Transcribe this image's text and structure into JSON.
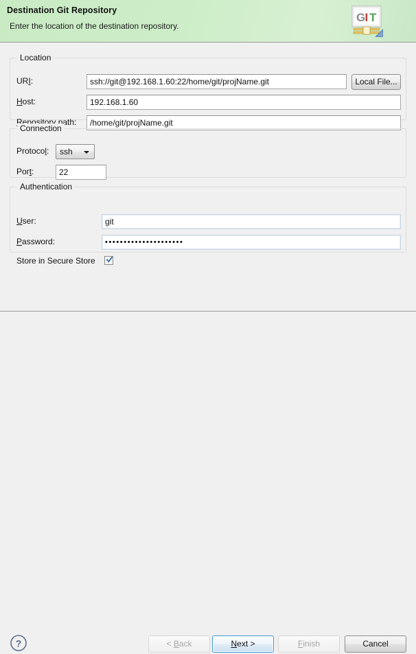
{
  "header": {
    "title": "Destination Git Repository",
    "subtitle": "Enter the location of the destination repository.",
    "logo": {
      "letter_g": "G",
      "letter_i": "I",
      "letter_t": "T"
    },
    "colors": {
      "banner_green": "#c9ebc4",
      "logo_g": "#808080",
      "logo_i": "#cc3333",
      "logo_t": "#4aa34a",
      "logo_bar": "#d9b64a"
    }
  },
  "groups": {
    "location": {
      "title": "Location",
      "uri": {
        "label_pre": "UR",
        "label_mn": "I",
        "label_post": ":",
        "value": "ssh://git@192.168.1.60:22/home/git/projName.git",
        "placeholder": ""
      },
      "local_file_button": "Local File...",
      "host": {
        "label_mn": "H",
        "label_post": "ost:",
        "value": "192.168.1.60",
        "placeholder": ""
      },
      "repo_path": {
        "label_mn": "R",
        "label_post": "epository path:",
        "value": "/home/git/projName.git",
        "placeholder": ""
      }
    },
    "connection": {
      "title": "Connection",
      "protocol": {
        "label_pre": "Protoco",
        "label_mn": "l",
        "label_post": ":",
        "value": "ssh",
        "options": [
          "ssh"
        ]
      },
      "port": {
        "label_pre": "Por",
        "label_mn": "t",
        "label_post": ":",
        "value": "22",
        "placeholder": ""
      }
    },
    "authentication": {
      "title": "Authentication",
      "user": {
        "label_mn": "U",
        "label_post": "ser:",
        "value": "git",
        "placeholder": ""
      },
      "password": {
        "label_mn": "P",
        "label_post": "assword:",
        "value": "•••••••••••••••••••••",
        "placeholder": ""
      },
      "store_secure": {
        "label": "Store in Secure Store",
        "checked": true
      }
    }
  },
  "footer": {
    "help_glyph": "?",
    "buttons": [
      {
        "id": "back",
        "label_pre": "< ",
        "label_mn": "B",
        "label_post": "ack",
        "enabled": false,
        "default": false
      },
      {
        "id": "next",
        "label_pre": "",
        "label_mn": "N",
        "label_post": "ext >",
        "enabled": true,
        "default": true
      },
      {
        "id": "finish",
        "label_pre": "",
        "label_mn": "F",
        "label_post": "inish",
        "enabled": false,
        "default": false
      },
      {
        "id": "cancel",
        "label_pre": "",
        "label_mn": "",
        "label_post": "Cancel",
        "enabled": true,
        "default": false
      }
    ]
  }
}
